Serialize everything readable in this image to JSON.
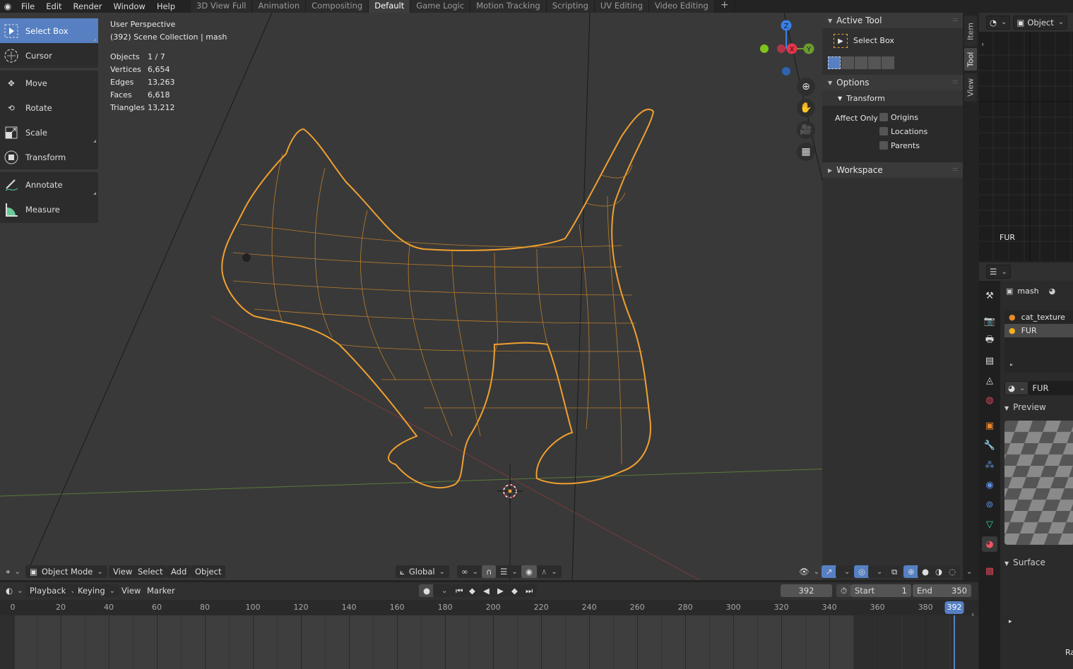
{
  "topbar": {
    "menus": [
      "File",
      "Edit",
      "Render",
      "Window",
      "Help"
    ],
    "workspace_tabs": [
      "3D View Full",
      "Animation",
      "Compositing",
      "Default",
      "Game Logic",
      "Motion Tracking",
      "Scripting",
      "UV Editing",
      "Video Editing"
    ],
    "active_tab": "Default",
    "add_tab": "+"
  },
  "toolbar": {
    "tools": [
      {
        "label": "Select Box",
        "icon": "select-box-icon",
        "active": true
      },
      {
        "label": "Cursor",
        "icon": "cursor-icon"
      },
      {
        "label": "Move",
        "icon": "move-icon"
      },
      {
        "label": "Rotate",
        "icon": "rotate-icon"
      },
      {
        "label": "Scale",
        "icon": "scale-icon"
      },
      {
        "label": "Transform",
        "icon": "transform-icon"
      },
      {
        "label": "Annotate",
        "icon": "annotate-icon"
      },
      {
        "label": "Measure",
        "icon": "measure-icon"
      }
    ]
  },
  "overlay": {
    "view_name": "User Perspective",
    "collection": "(392) Scene Collection | mash",
    "stats": [
      {
        "label": "Objects",
        "value": "1 / 7"
      },
      {
        "label": "Vertices",
        "value": "6,654"
      },
      {
        "label": "Edges",
        "value": "13,263"
      },
      {
        "label": "Faces",
        "value": "6,618"
      },
      {
        "label": "Triangles",
        "value": "13,212"
      }
    ]
  },
  "gizmo": {
    "axes": [
      "Z",
      "X",
      "Y"
    ],
    "colors": {
      "x": "#e8344c",
      "y": "#6c9c2c",
      "z": "#3a80e8"
    }
  },
  "npanel": {
    "active_tool_header": "Active Tool",
    "active_tool_name": "Select Box",
    "options_header": "Options",
    "transform_header": "Transform",
    "affect_only_label": "Affect Only",
    "checkboxes": [
      "Origins",
      "Locations",
      "Parents"
    ],
    "workspace_header": "Workspace",
    "tabs": [
      "Item",
      "Tool",
      "View"
    ],
    "active_tab": "Tool"
  },
  "viewport_header": {
    "mode": "Object Mode",
    "menus": [
      "View",
      "Select",
      "Add",
      "Object"
    ],
    "orientation": "Global"
  },
  "shader_editor": {
    "object_selector": "Object",
    "node_label": "FUR"
  },
  "properties": {
    "breadcrumb_object": "mash",
    "materials": [
      "cat_texture",
      "FUR"
    ],
    "selected_material": "FUR",
    "material_name": "FUR",
    "preview_header": "Preview",
    "surface_header": "Surface",
    "truncated_label": "Ra"
  },
  "timeline": {
    "menus": [
      "Playback",
      "Keying",
      "View",
      "Marker"
    ],
    "current_frame": "392",
    "start_label": "Start",
    "start": "1",
    "end_label": "End",
    "end": "350",
    "ticks": [
      "0",
      "20",
      "40",
      "60",
      "80",
      "100",
      "120",
      "140",
      "160",
      "180",
      "200",
      "220",
      "240",
      "260",
      "280",
      "300",
      "320",
      "340",
      "360",
      "380"
    ],
    "playhead": "392"
  },
  "colors": {
    "accent": "#5680c2",
    "selection": "#f0a030"
  }
}
